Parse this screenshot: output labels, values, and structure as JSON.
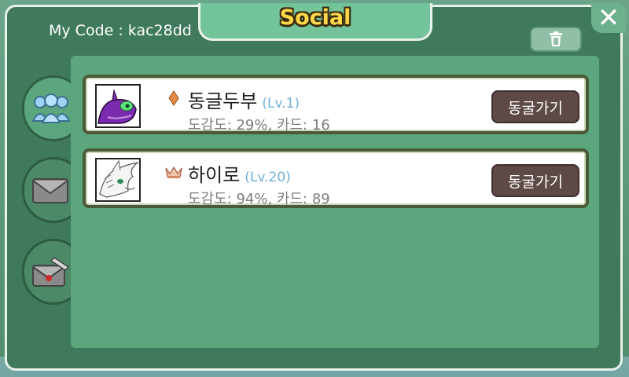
{
  "header": {
    "title": "Social",
    "my_code": "My Code : kac28dd",
    "close_icon": "close-icon",
    "trash_icon": "trash-icon"
  },
  "side_tabs": [
    {
      "icon": "friends-icon",
      "active": true
    },
    {
      "icon": "mail-icon",
      "active": false
    },
    {
      "icon": "letter-write-icon",
      "active": false
    }
  ],
  "friends": [
    {
      "name": "동글두부",
      "level": "(Lv.1)",
      "stats": "도감도: 29%, 카드: 16",
      "rank_icon": "diamond-icon",
      "button_label": "동굴가기"
    },
    {
      "name": "하이로",
      "level": "(Lv.20)",
      "stats": "도감도: 94%, 카드: 89",
      "rank_icon": "crown-icon",
      "button_label": "동굴가기"
    }
  ],
  "colors": {
    "panel": "#3f7a5c",
    "content": "#5ca67e",
    "title": "#ffd84a",
    "level": "#6fb2d8",
    "button": "#5d4a47"
  }
}
